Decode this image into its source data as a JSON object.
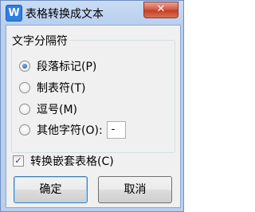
{
  "window": {
    "title": "表格转换成文本",
    "app_icon_glyph": "W",
    "close_glyph": "✕"
  },
  "separator_group": {
    "label": "文字分隔符",
    "options": [
      {
        "label": "段落标记(P)",
        "checked": true
      },
      {
        "label": "制表符(T)",
        "checked": false
      },
      {
        "label": "逗号(M)",
        "checked": false
      },
      {
        "label": "其他字符(O):",
        "checked": false
      }
    ],
    "other_char_value": "-"
  },
  "nested_table": {
    "label": "转换嵌套表格(C)",
    "checked": true,
    "check_glyph": "✓"
  },
  "buttons": {
    "ok_label": "确定",
    "cancel_label": "取消"
  },
  "colors": {
    "accent": "#2f7fe0",
    "close_button": "#c43c25",
    "frame": "#b9cfee"
  }
}
